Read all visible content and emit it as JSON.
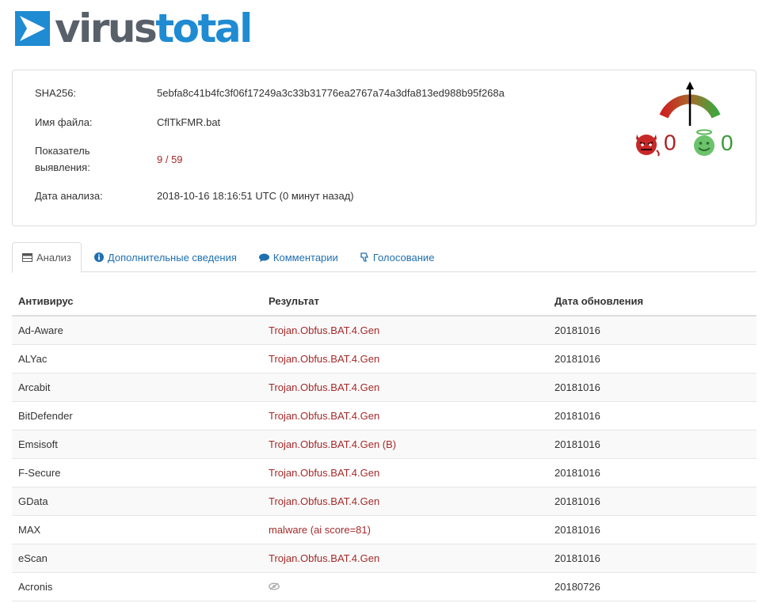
{
  "brand": {
    "part1": "virus",
    "part2": "total"
  },
  "colors": {
    "brand_blue": "#1f8bd2",
    "brand_gray": "#58606a",
    "detected": "#a52a2a",
    "link": "#1f6fb2"
  },
  "file": {
    "sha256_label": "SHA256:",
    "sha256_value": "5ebfa8c41b4fc3f06f17249a3c33b31776ea2767a74a3dfa813ed988b95f268a",
    "filename_label": "Имя файла:",
    "filename_value": "CflTkFMR.bat",
    "detection_label": "Показатель выявления:",
    "detection_value": "9 / 59",
    "date_label": "Дата анализа:",
    "date_value": "2018-10-16 18:16:51 UTC (0 минут назад)"
  },
  "votes": {
    "malicious": "0",
    "harmless": "0",
    "malicious_icon": "devil-icon",
    "harmless_icon": "angel-icon"
  },
  "tabs": [
    {
      "label": "Анализ",
      "icon": "table-icon",
      "active": true
    },
    {
      "label": "Дополнительные сведения",
      "icon": "info-icon",
      "active": false
    },
    {
      "label": "Комментарии",
      "icon": "comment-icon",
      "active": false
    },
    {
      "label": "Голосование",
      "icon": "thumbs-icon",
      "active": false
    }
  ],
  "table": {
    "headers": {
      "antivirus": "Антивирус",
      "result": "Результат",
      "date": "Дата обновления"
    },
    "rows": [
      {
        "av": "Ad-Aware",
        "result": "Trojan.Obfus.BAT.4.Gen",
        "date": "20181016"
      },
      {
        "av": "ALYac",
        "result": "Trojan.Obfus.BAT.4.Gen",
        "date": "20181016"
      },
      {
        "av": "Arcabit",
        "result": "Trojan.Obfus.BAT.4.Gen",
        "date": "20181016"
      },
      {
        "av": "BitDefender",
        "result": "Trojan.Obfus.BAT.4.Gen",
        "date": "20181016"
      },
      {
        "av": "Emsisoft",
        "result": "Trojan.Obfus.BAT.4.Gen (B)",
        "date": "20181016"
      },
      {
        "av": "F-Secure",
        "result": "Trojan.Obfus.BAT.4.Gen",
        "date": "20181016"
      },
      {
        "av": "GData",
        "result": "Trojan.Obfus.BAT.4.Gen",
        "date": "20181016"
      },
      {
        "av": "MAX",
        "result": "malware (ai score=81)",
        "date": "20181016"
      },
      {
        "av": "eScan",
        "result": "Trojan.Obfus.BAT.4.Gen",
        "date": "20181016"
      },
      {
        "av": "Acronis",
        "result": "",
        "result_icon": "unsupported-eye-icon",
        "date": "20180726"
      }
    ]
  }
}
